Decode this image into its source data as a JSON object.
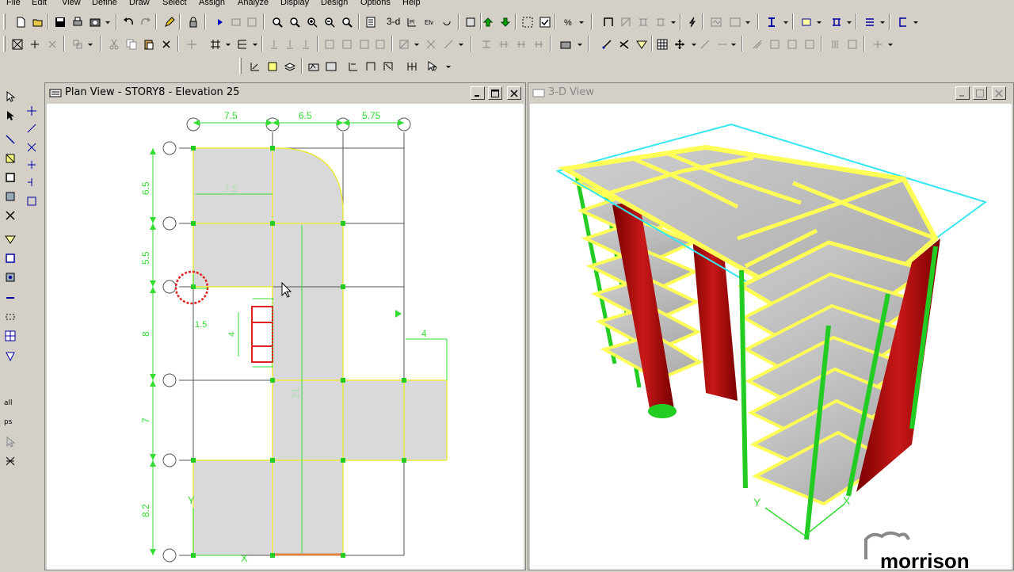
{
  "menu": {
    "file": "File",
    "edit": "Edit",
    "view": "View",
    "define": "Define",
    "draw": "Draw",
    "select": "Select",
    "assign": "Assign",
    "analyze": "Analyze",
    "display": "Display",
    "design": "Design",
    "options": "Options",
    "help": "Help"
  },
  "toolbar": {
    "view3d_label": "3-d",
    "all_label": "all",
    "ps_label": "ps"
  },
  "plan_window": {
    "title": "Plan View - STORY8 - Elevation 25",
    "top_dims": [
      "7.5",
      "6.5",
      "5.75"
    ],
    "side_dims": [
      "6.5",
      "5.5",
      "8",
      "7",
      "8.2"
    ],
    "inner_dims": {
      "slab_width": "7.5",
      "cantilever": "4",
      "wall_length": "21",
      "small_a": "1.5",
      "small_b": "4"
    },
    "axis_x": "X",
    "axis_y": "Y"
  },
  "view3d_window": {
    "title": "3-D View",
    "axis_x": "X",
    "axis_y": "Y"
  },
  "watermark": "morrison",
  "colors": {
    "slab_fill": "#d9d9d9",
    "beam_yellow": "#ffff66",
    "column_green": "#22cc22",
    "wall_red": "#b01010",
    "dim_green": "#33dd33",
    "selection_cyan": "#33e6f0",
    "circle_red": "#e02020"
  }
}
